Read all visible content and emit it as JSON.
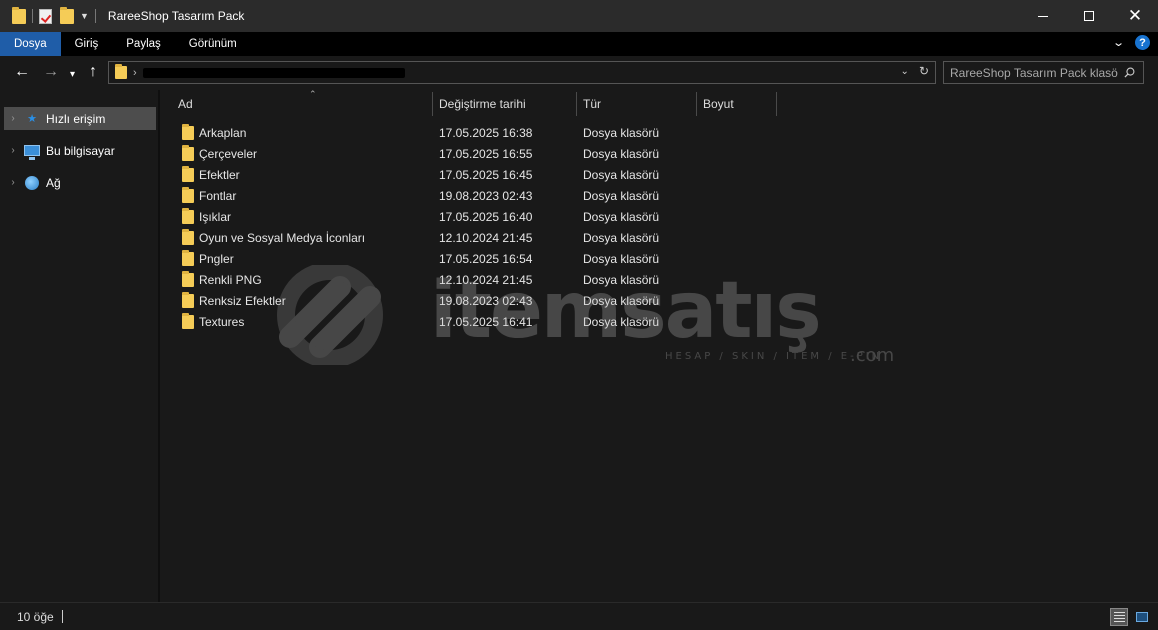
{
  "window": {
    "title": "RareeShop Tasarım Pack"
  },
  "ribbon": {
    "tabs": [
      {
        "label": "Dosya",
        "active": true
      },
      {
        "label": "Giriş",
        "active": false
      },
      {
        "label": "Paylaş",
        "active": false
      },
      {
        "label": "Görünüm",
        "active": false
      }
    ],
    "help_label": "?"
  },
  "address_bar": {
    "path_visible": false
  },
  "search": {
    "placeholder": "RareeShop Tasarım Pack klasörü..."
  },
  "sidebar": {
    "items": [
      {
        "label": "Hızlı erişim",
        "icon": "star-icon",
        "selected": true
      },
      {
        "label": "Bu bilgisayar",
        "icon": "computer-icon",
        "selected": false
      },
      {
        "label": "Ağ",
        "icon": "network-icon",
        "selected": false
      }
    ]
  },
  "file_list": {
    "columns": [
      "Ad",
      "Değiştirme tarihi",
      "Tür",
      "Boyut"
    ],
    "rows": [
      {
        "name": "Arkaplan",
        "modified": "17.05.2025 16:38",
        "type": "Dosya klasörü",
        "size": ""
      },
      {
        "name": "Çerçeveler",
        "modified": "17.05.2025 16:55",
        "type": "Dosya klasörü",
        "size": ""
      },
      {
        "name": "Efektler",
        "modified": "17.05.2025 16:45",
        "type": "Dosya klasörü",
        "size": ""
      },
      {
        "name": "Fontlar",
        "modified": "19.08.2023 02:43",
        "type": "Dosya klasörü",
        "size": ""
      },
      {
        "name": "Işıklar",
        "modified": "17.05.2025 16:40",
        "type": "Dosya klasörü",
        "size": ""
      },
      {
        "name": "Oyun ve Sosyal Medya İconları",
        "modified": "12.10.2024 21:45",
        "type": "Dosya klasörü",
        "size": ""
      },
      {
        "name": "Pngler",
        "modified": "17.05.2025 16:54",
        "type": "Dosya klasörü",
        "size": ""
      },
      {
        "name": "Renkli PNG",
        "modified": "12.10.2024 21:45",
        "type": "Dosya klasörü",
        "size": ""
      },
      {
        "name": "Renksiz Efektler",
        "modified": "19.08.2023 02:43",
        "type": "Dosya klasörü",
        "size": ""
      },
      {
        "name": "Textures",
        "modified": "17.05.2025 16:41",
        "type": "Dosya klasörü",
        "size": ""
      }
    ]
  },
  "watermark": {
    "brand": "itemsatış",
    "tagline": "HESAP / SKIN / ITEM / E-PIN",
    "suffix": ".com"
  },
  "status_bar": {
    "item_count": "10 öğe"
  },
  "colors": {
    "background": "#191919",
    "title_bar": "#2b2b2b",
    "active_tab": "#1f5da8",
    "folder": "#f5cc57",
    "selection": "#4d4d4d"
  }
}
